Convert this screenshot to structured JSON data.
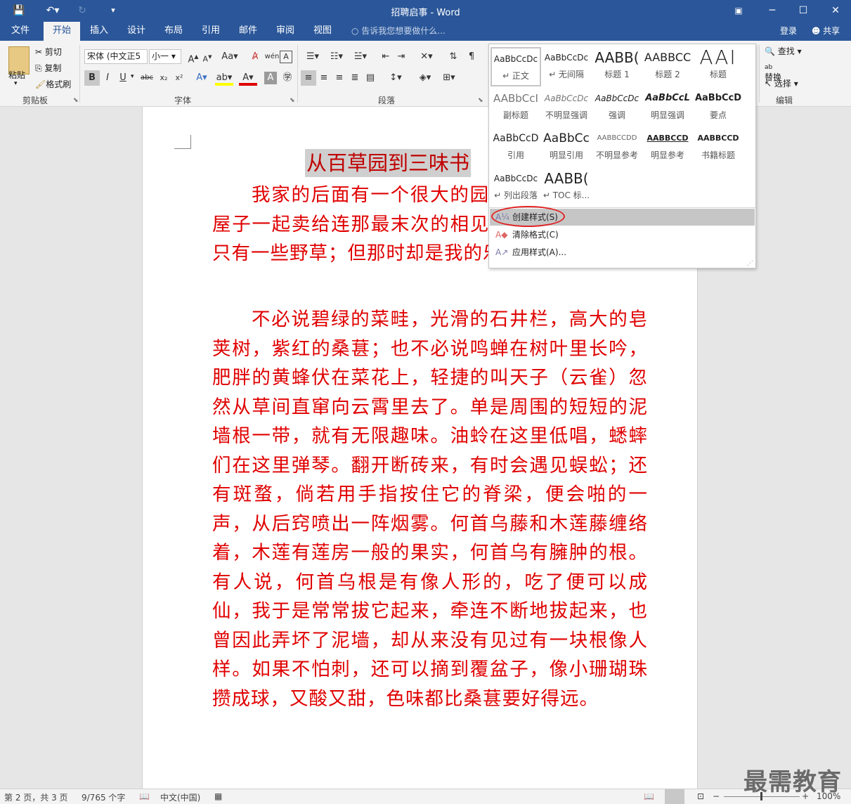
{
  "window": {
    "title": "招聘启事 - Word"
  },
  "tabs": [
    "文件",
    "开始",
    "插入",
    "设计",
    "布局",
    "引用",
    "邮件",
    "审阅",
    "视图"
  ],
  "tell_me": "告诉我您想要做什么...",
  "account": {
    "login": "登录",
    "share": "共享"
  },
  "clipboard": {
    "paste": "粘贴",
    "cut": "剪切",
    "copy": "复制",
    "format_painter": "格式刷",
    "label": "剪贴板"
  },
  "font": {
    "name": "宋体 (中文正5",
    "size": "小一",
    "label": "字体",
    "bold": "B",
    "italic": "I",
    "underline": "U",
    "strike": "abc",
    "sub": "x₂",
    "sup": "x²",
    "case": "Aa",
    "grow": "A",
    "shrink": "A"
  },
  "paragraph": {
    "label": "段落"
  },
  "editing": {
    "find": "查找",
    "replace": "替换",
    "select": "选择",
    "label": "编辑"
  },
  "styles": [
    {
      "preview": "AaBbCcDc",
      "name": "↵ 正文"
    },
    {
      "preview": "AaBbCcDc",
      "name": "↵ 无间隔"
    },
    {
      "preview": "AABB(",
      "name": "标题 1"
    },
    {
      "preview": "AABBCC",
      "name": "标题 2"
    },
    {
      "preview": "AAI",
      "name": "标题"
    },
    {
      "preview": "AABbCcI",
      "name": "副标题"
    },
    {
      "preview": "AaBbCcDc",
      "name": "不明显强调"
    },
    {
      "preview": "AaBbCcDc",
      "name": "强调"
    },
    {
      "preview": "AaBbCcL",
      "name": "明显强调"
    },
    {
      "preview": "AaBbCcD",
      "name": "要点"
    },
    {
      "preview": "AaBbCcD",
      "name": "引用"
    },
    {
      "preview": "AaBbCc",
      "name": "明显引用"
    },
    {
      "preview": "AABBCCDD",
      "name": "不明显参考"
    },
    {
      "preview": "AABBCCD",
      "name": "明显参考"
    },
    {
      "preview": "AABBCCD",
      "name": "书籍标题"
    },
    {
      "preview": "AaBbCcDc",
      "name": "↵ 列出段落"
    },
    {
      "preview": "AABB(",
      "name": "↵ TOC 标..."
    }
  ],
  "style_menu": {
    "create": "创建样式(S)",
    "clear": "清除格式(C)",
    "apply": "应用样式(A)..."
  },
  "document": {
    "title": "从百草园到三味书",
    "para1": "我家的后面有一个很大的园，相传叫作百草园。现在是早已并屋子一起卖给朱文公的子孙了，连那最末次的相见也已经隔了七八年，其中似乎确凿只有一些野草；但那时却是我的乐园。",
    "para1_display": "我家的后面有一个很大的园园。现在是早已并屋子一起卖给连那最末次的相见也已经隔了七确凿只有一些野草；但那时却是我的乐园。",
    "para2": "不必说碧绿的菜畦，光滑的石井栏，高大的皂荚树，紫红的桑葚；也不必说鸣蝉在树叶里长吟，肥胖的黄蜂伏在菜花上，轻捷的叫天子（云雀）忽然从草间直窜向云霄里去了。单是周围的短短的泥墙根一带，就有无限趣味。油蛉在这里低唱，蟋蟀们在这里弹琴。翻开断砖来，有时会遇见蜈蚣；还有斑蝥，倘若用手指按住它的脊梁，便会啪的一声，从后窍喷出一阵烟雾。何首乌藤和木莲藤缠络着，木莲有莲房一般的果实，何首乌有臃肿的根。有人说，何首乌根是有像人形的，吃了便可以成仙，我于是常常拔它起来，牵连不断地拔起来，也曾因此弄坏了泥墙，却从来没有见过有一块根像人样。如果不怕刺，还可以摘到覆盆子，像小珊瑚珠攒成球，又酸又甜，色味都比桑葚要好得远。"
  },
  "status": {
    "page": "第 2 页，共 3 页",
    "words": "9/765 个字",
    "lang": "中文(中国)",
    "zoom": "100%"
  },
  "watermark": "最需教育",
  "colors": {
    "accent": "#2b579a",
    "text_red": "#e00000",
    "title_red": "#c00000"
  }
}
